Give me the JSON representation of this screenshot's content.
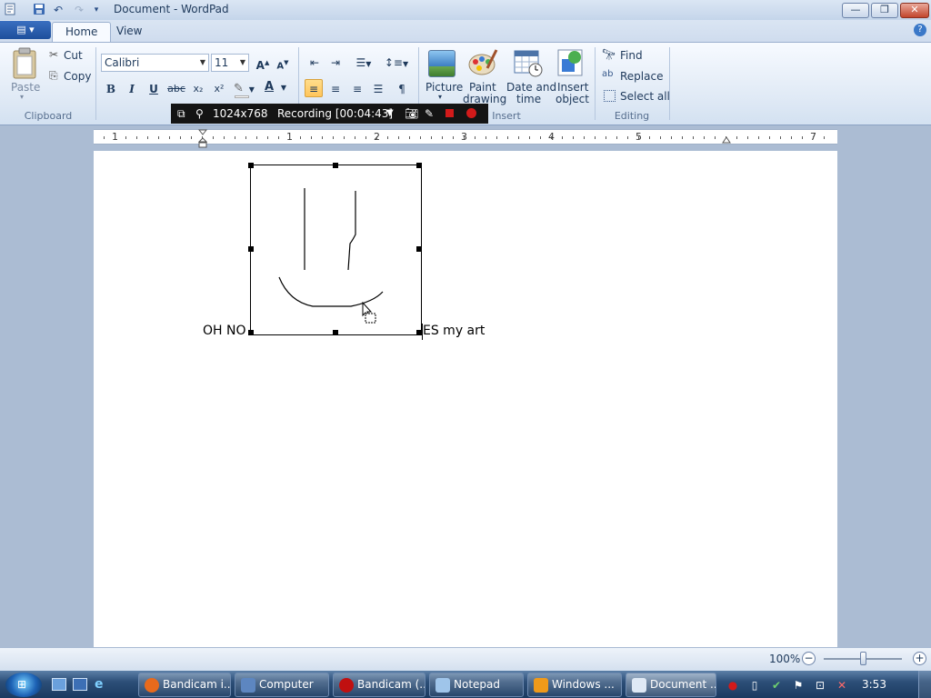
{
  "window": {
    "title": "Document - WordPad"
  },
  "tabs": [
    {
      "label": "Home"
    },
    {
      "label": "View"
    }
  ],
  "help_glyph": "?",
  "clipboard": {
    "paste": "Paste",
    "cut": "Cut",
    "copy": "Copy",
    "group": "Clipboard"
  },
  "font": {
    "family": "Calibri",
    "size": "11",
    "bold": "B",
    "italic": "I",
    "underline": "U",
    "strike": "abc",
    "subscript": "x₂",
    "superscript": "x²",
    "grow": "A",
    "shrink": "A",
    "color_letter": "A"
  },
  "insert": {
    "picture": "Picture",
    "paint_1": "Paint",
    "paint_2": "drawing",
    "date_1": "Date and",
    "date_2": "time",
    "object_1": "Insert",
    "object_2": "object",
    "group": "Insert"
  },
  "editing": {
    "find": "Find",
    "replace": "Replace",
    "select_all": "Select all",
    "group": "Editing"
  },
  "recording": {
    "resolution": "1024x768",
    "status": "Recording [00:04:43]"
  },
  "ruler": {
    "numbers": [
      "1",
      "1",
      "2",
      "3",
      "4",
      "5",
      "7"
    ]
  },
  "document": {
    "text_before": "OH NO",
    "text_after": "ES my art"
  },
  "status": {
    "zoom": "100%",
    "zoom_level": 1.0
  },
  "taskbar": {
    "items": [
      {
        "label": "Bandicam i..."
      },
      {
        "label": "Computer"
      },
      {
        "label": "Bandicam (..."
      },
      {
        "label": "Notepad"
      },
      {
        "label": "Windows ..."
      },
      {
        "label": "Document ..."
      }
    ],
    "clock": "3:53"
  },
  "colors": {
    "accent": "#ffc55a",
    "taskbar": "#2d4f78",
    "ribbon": "#dfe9f5"
  }
}
